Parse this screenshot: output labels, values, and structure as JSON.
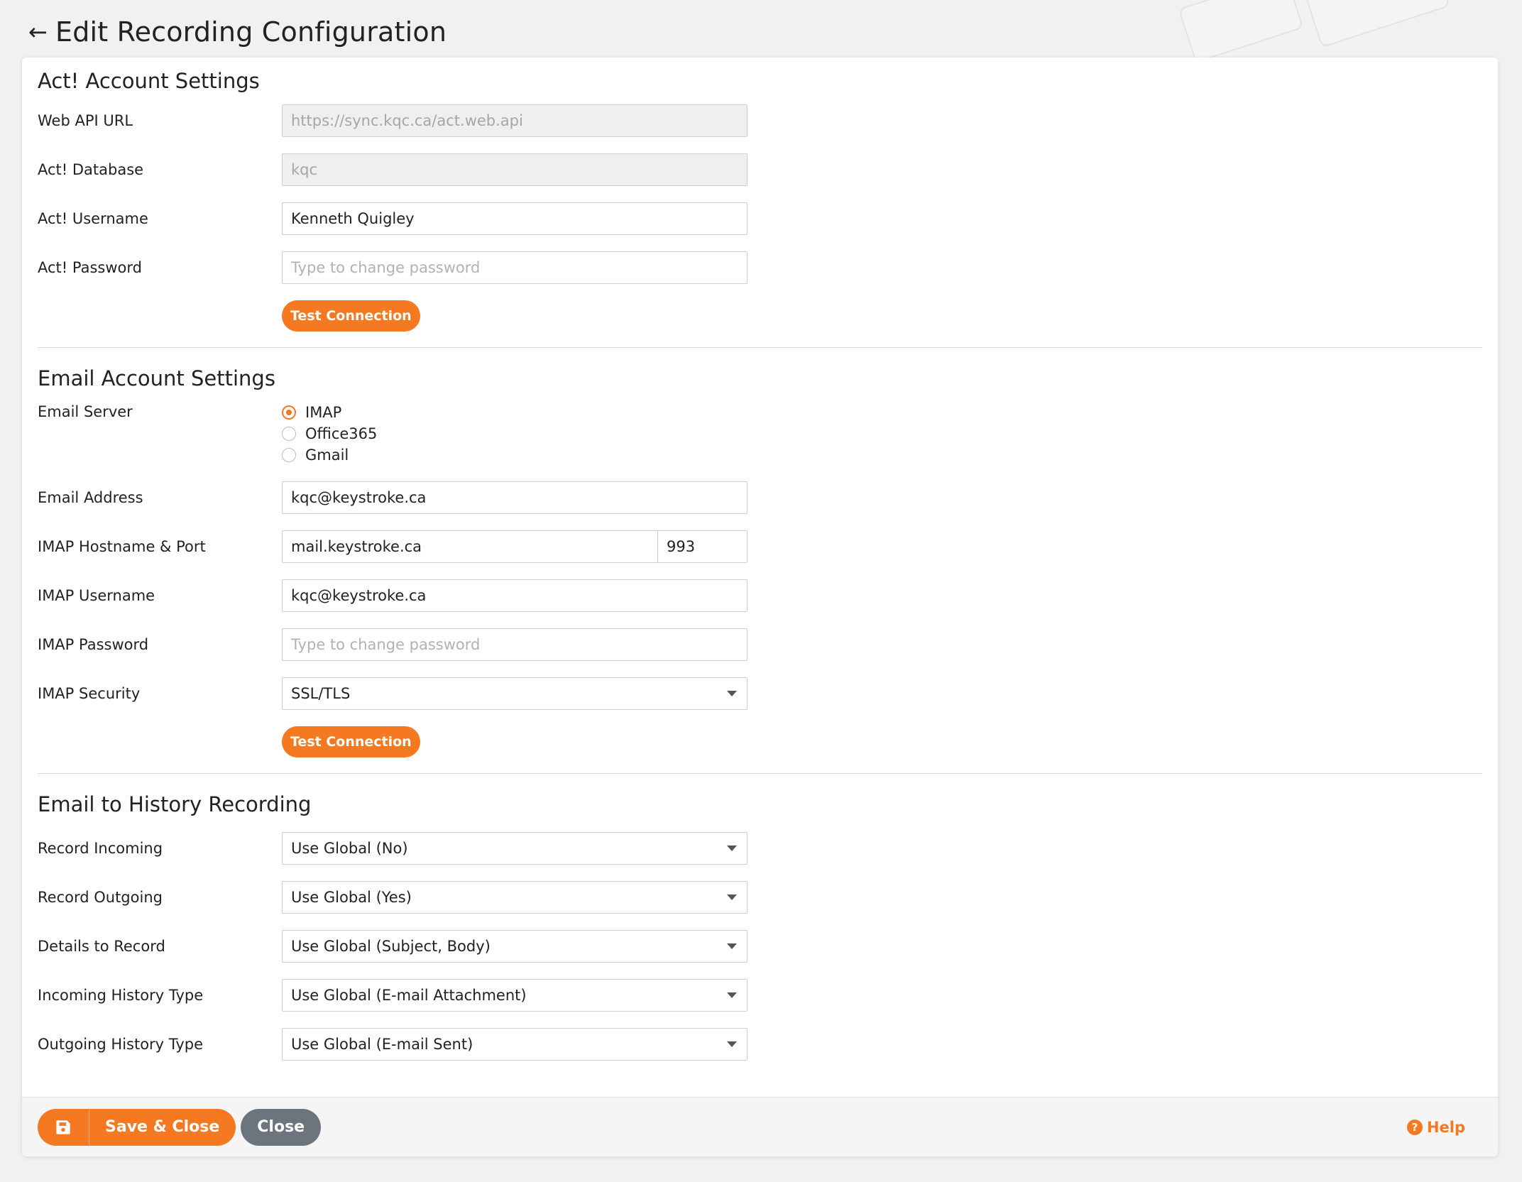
{
  "header": {
    "title": "Edit Recording Configuration",
    "back_icon": "arrow-left-icon",
    "back_glyph": "←"
  },
  "act_section": {
    "title": "Act! Account Settings",
    "web_api_url": {
      "label": "Web API URL",
      "value": "https://sync.kqc.ca/act.web.api"
    },
    "database": {
      "label": "Act! Database",
      "value": "kqc"
    },
    "username": {
      "label": "Act! Username",
      "value": "Kenneth Quigley"
    },
    "password": {
      "label": "Act! Password",
      "placeholder": "Type to change password"
    },
    "test_button": "Test Connection"
  },
  "email_section": {
    "title": "Email Account Settings",
    "server": {
      "label": "Email Server",
      "options": [
        "IMAP",
        "Office365",
        "Gmail"
      ],
      "selected": "IMAP"
    },
    "address": {
      "label": "Email Address",
      "value": "kqc@keystroke.ca"
    },
    "host_port": {
      "label": "IMAP Hostname & Port",
      "host": "mail.keystroke.ca",
      "port": "993"
    },
    "imap_username": {
      "label": "IMAP Username",
      "value": "kqc@keystroke.ca"
    },
    "imap_password": {
      "label": "IMAP Password",
      "placeholder": "Type to change password"
    },
    "imap_security": {
      "label": "IMAP Security",
      "value": "SSL/TLS"
    },
    "test_button": "Test Connection"
  },
  "history_section": {
    "title": "Email to History Recording",
    "record_incoming": {
      "label": "Record Incoming",
      "value": "Use Global (No)"
    },
    "record_outgoing": {
      "label": "Record Outgoing",
      "value": "Use Global (Yes)"
    },
    "details": {
      "label": "Details to Record",
      "value": "Use Global (Subject, Body)"
    },
    "incoming_type": {
      "label": "Incoming History Type",
      "value": "Use Global (E-mail Attachment)"
    },
    "outgoing_type": {
      "label": "Outgoing History Type",
      "value": "Use Global (E-mail Sent)"
    }
  },
  "footer": {
    "save_label": "Save & Close",
    "save_icon": "floppy-disk-icon",
    "close_label": "Close",
    "help_label": "Help",
    "help_icon": "question-circle-icon",
    "help_glyph": "?"
  },
  "colors": {
    "accent": "#f47920",
    "secondary_button": "#6c757d",
    "background": "#f1f1f1"
  }
}
